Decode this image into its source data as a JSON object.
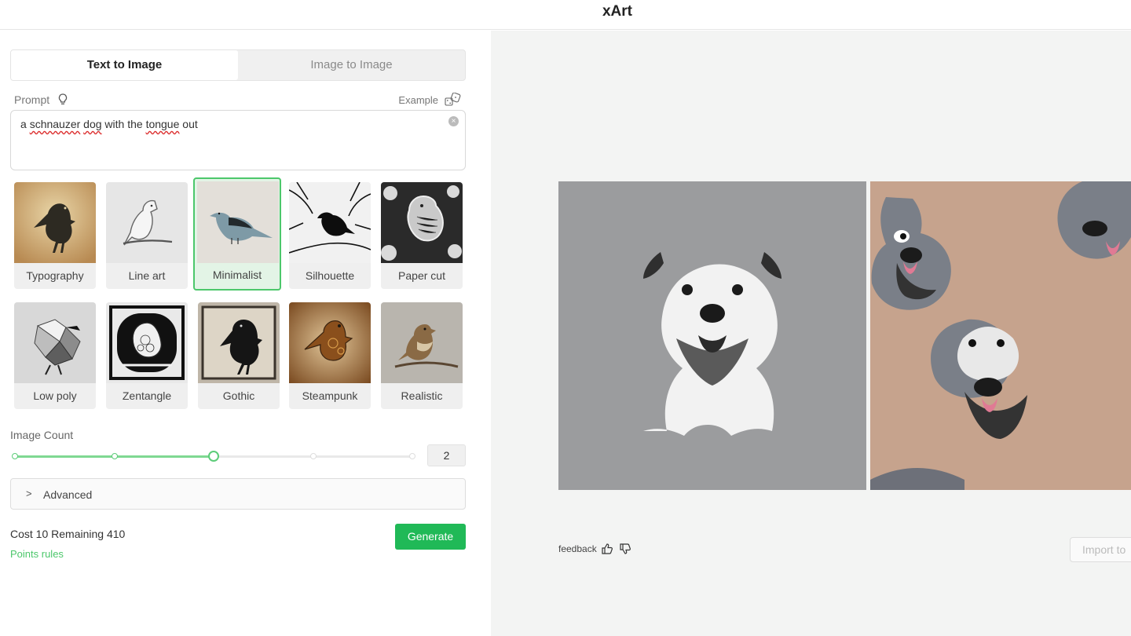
{
  "app": {
    "title": "xArt"
  },
  "tabs": [
    {
      "label": "Text to Image",
      "active": true
    },
    {
      "label": "Image to Image",
      "active": false
    }
  ],
  "prompt": {
    "label": "Prompt",
    "example_label": "Example",
    "words": [
      {
        "text": "a ",
        "flagged": false
      },
      {
        "text": "schnauzer",
        "flagged": true
      },
      {
        "text": " ",
        "flagged": false
      },
      {
        "text": "dog",
        "flagged": true
      },
      {
        "text": " with the ",
        "flagged": false
      },
      {
        "text": "tongue",
        "flagged": true
      },
      {
        "text": " out",
        "flagged": false
      }
    ]
  },
  "styles": [
    {
      "label": "Typography",
      "selected": false
    },
    {
      "label": "Line art",
      "selected": false
    },
    {
      "label": "Minimalist",
      "selected": true
    },
    {
      "label": "Silhouette",
      "selected": false
    },
    {
      "label": "Paper cut",
      "selected": false
    },
    {
      "label": "Low poly",
      "selected": false
    },
    {
      "label": "Zentangle",
      "selected": false
    },
    {
      "label": "Gothic",
      "selected": false
    },
    {
      "label": "Steampunk",
      "selected": false
    },
    {
      "label": "Realistic",
      "selected": false
    }
  ],
  "image_count": {
    "label": "Image Count",
    "value": "2",
    "steps": 5,
    "selected_step": 3
  },
  "advanced": {
    "label": "Advanced"
  },
  "footer": {
    "cost_text": "Cost 10 Remaining 410",
    "points_rules": "Points rules",
    "generate_label": "Generate"
  },
  "results": {
    "feedback_label": "feedback",
    "import_label": "Import to"
  },
  "colors": {
    "accent": "#20b957",
    "selected_border": "#4cc76b",
    "slider_fill": "#7fd892",
    "result_bg": "#f3f4f3"
  }
}
